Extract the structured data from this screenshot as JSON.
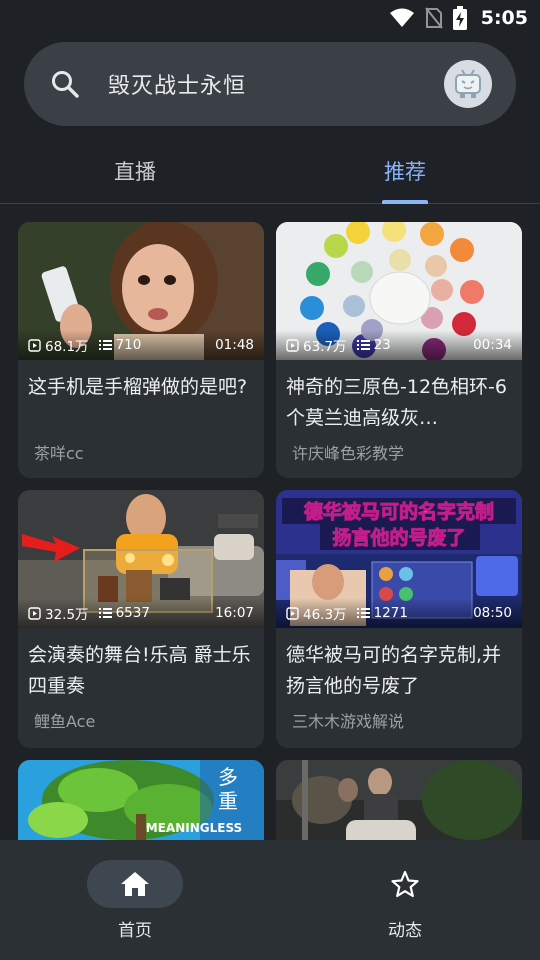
{
  "status": {
    "time": "5:05",
    "icons": [
      "wifi-icon",
      "no-sim-icon",
      "battery-charging-icon"
    ]
  },
  "search": {
    "query": "毁灭战士永恒",
    "icon": "search-icon",
    "avatar_icon": "tv-mascot-avatar"
  },
  "tabs": [
    {
      "label": "直播",
      "active": false
    },
    {
      "label": "推荐",
      "active": true
    }
  ],
  "videos": [
    {
      "views": "68.1万",
      "danmaku": "710",
      "duration": "01:48",
      "title": "这手机是手榴弹做的是吧?",
      "author": "茶咩cc"
    },
    {
      "views": "63.7万",
      "danmaku": "23",
      "duration": "00:34",
      "title": "神奇的三原色-12色相环-6个莫兰迪高级灰…",
      "author": "许庆峰色彩教学"
    },
    {
      "views": "32.5万",
      "danmaku": "6537",
      "duration": "16:07",
      "title": "会演奏的舞台!乐高 爵士乐四重奏",
      "author": "鲤鱼Ace"
    },
    {
      "views": "46.3万",
      "danmaku": "1271",
      "duration": "08:50",
      "title": "德华被马可的名字克制,并扬言他的号废了",
      "author": "三木木游戏解说"
    },
    {
      "title": "",
      "author": ""
    },
    {
      "title": "",
      "author": ""
    }
  ],
  "thumb_text": {
    "t4_line1": "德华被马可的名字克制",
    "t4_line2": "扬言他的号废了",
    "t5_side1": "多",
    "t5_side2": "重",
    "t5_caption": "MEANINGLESS"
  },
  "bottom_nav": [
    {
      "label": "首页",
      "icon": "home-icon",
      "active": true
    },
    {
      "label": "动态",
      "icon": "star-icon",
      "active": false
    }
  ],
  "colors": {
    "background": "#1e2226",
    "card": "#2b3035",
    "accent": "#8ab4f8"
  }
}
